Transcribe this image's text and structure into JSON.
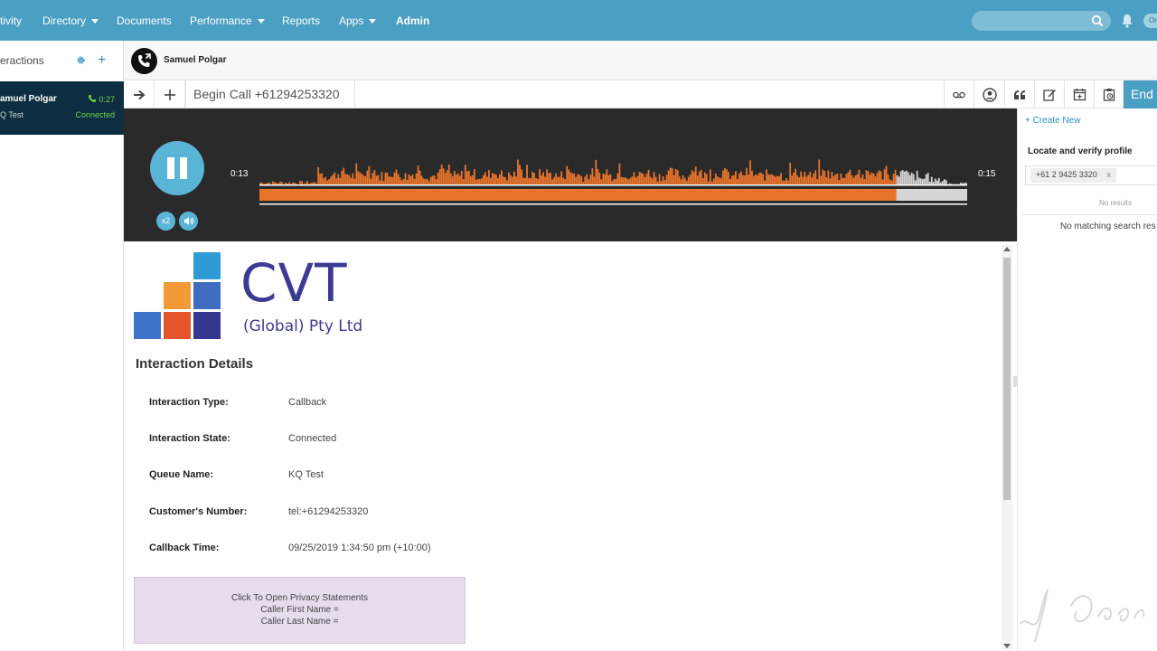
{
  "nav": {
    "items": [
      {
        "label": "tivity",
        "caret": false
      },
      {
        "label": "Directory",
        "caret": true
      },
      {
        "label": "Documents",
        "caret": false
      },
      {
        "label": "Performance",
        "caret": true
      },
      {
        "label": "Reports",
        "caret": false
      },
      {
        "label": "Apps",
        "caret": true
      },
      {
        "label": "Admin",
        "caret": false
      }
    ],
    "search_placeholder": "",
    "status_label": "On",
    "accent_color": "#4a9fc3"
  },
  "left": {
    "title": "eractions",
    "card": {
      "name": "amuel Polgar",
      "queue": "Q Test",
      "timer": "0:27",
      "status": "Connected"
    }
  },
  "contact": {
    "name": "Samuel Polgar"
  },
  "toolbar": {
    "title": "Begin Call +61294253320",
    "end_label": "End",
    "icons": [
      "voicemail-icon",
      "user-icon",
      "quote-icon",
      "edit-icon",
      "calendar-add-icon",
      "clipboard-icon"
    ]
  },
  "player": {
    "time_current": "0:13",
    "time_total": "0:15",
    "speed_label": "x2",
    "progress": 0.9
  },
  "right": {
    "create_new": "+ Create New",
    "locate_title": "Locate and verify profile",
    "phone_chip": "+61 2 9425 3320",
    "chip_remove": "x",
    "no_results": "No results",
    "no_match": "No matching search res"
  },
  "content": {
    "logo": {
      "main": "CVT",
      "sub": "(Global) Pty Ltd"
    },
    "heading": "Interaction Details",
    "details": [
      {
        "label": "Interaction Type:",
        "value": "Callback"
      },
      {
        "label": "Interaction State:",
        "value": "Connected"
      },
      {
        "label": "Queue Name:",
        "value": "KQ Test"
      },
      {
        "label": "Customer's Number:",
        "value": "tel:+61294253320"
      },
      {
        "label": "Callback Time:",
        "value": "09/25/2019 1:34:50 pm (+10:00)"
      }
    ],
    "privacy": {
      "line1": "Click To Open Privacy Statements",
      "line2": "Caller First Name =",
      "line3": "Caller Last Name ="
    }
  }
}
